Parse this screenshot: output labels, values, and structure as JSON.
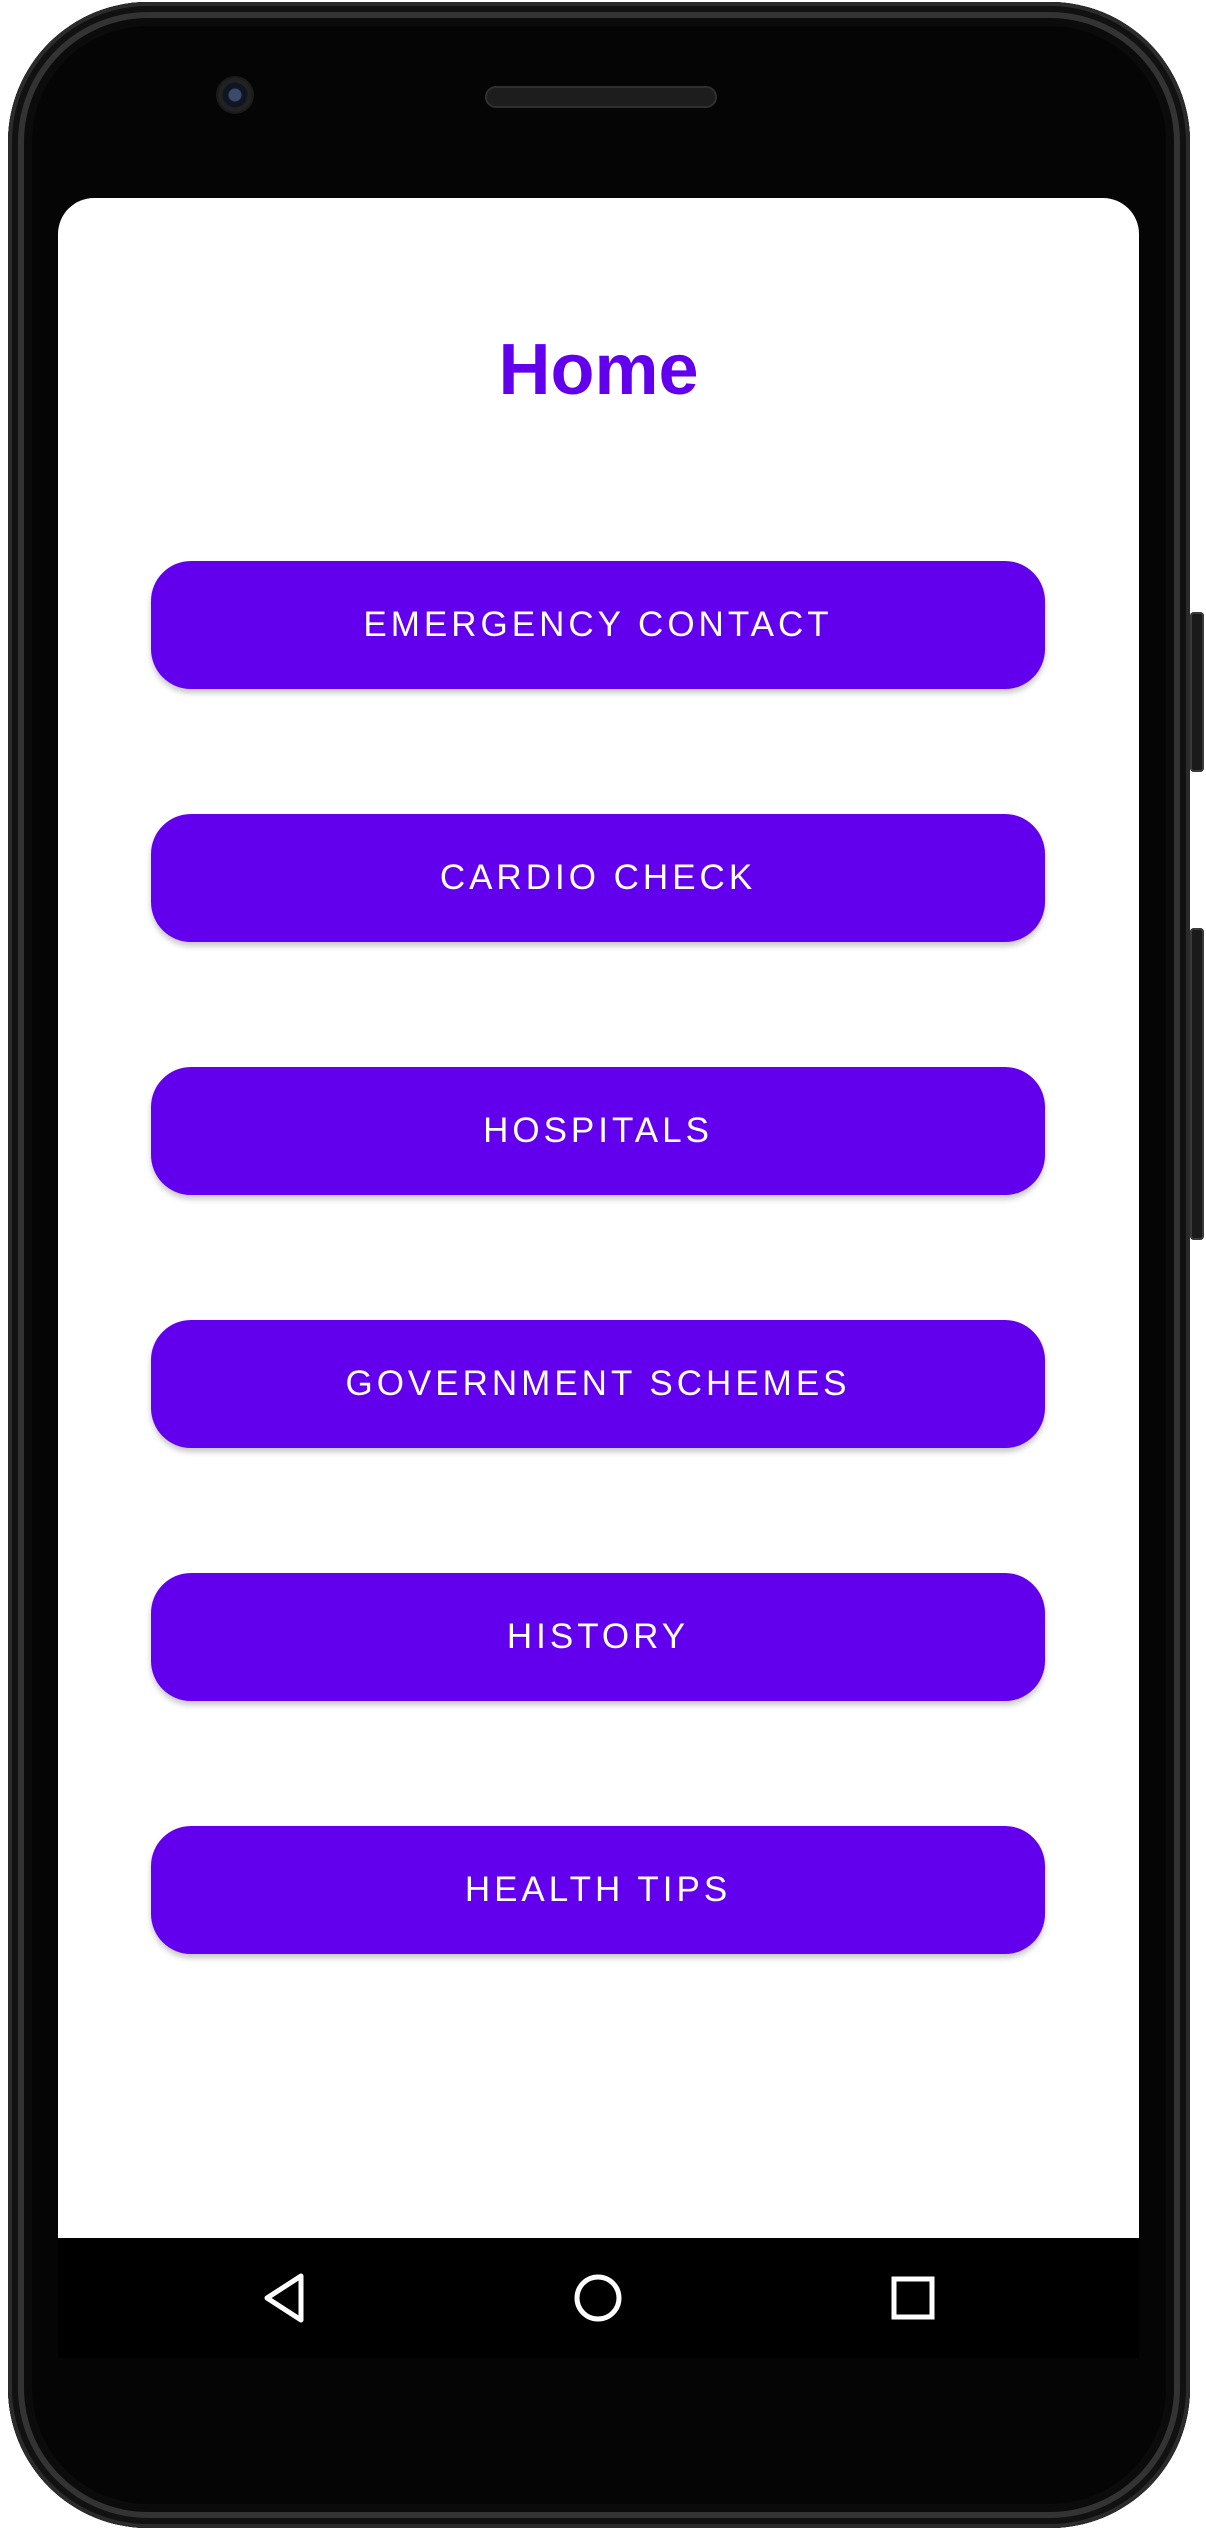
{
  "screen": {
    "title": "Home"
  },
  "menu": {
    "buttons": [
      {
        "label": "EMERGENCY CONTACT"
      },
      {
        "label": "CARDIO CHECK"
      },
      {
        "label": "HOSPITALS"
      },
      {
        "label": "GOVERNMENT SCHEMES"
      },
      {
        "label": "HISTORY"
      },
      {
        "label": "HEALTH TIPS"
      }
    ]
  },
  "navigation": {
    "icons": [
      "back-icon",
      "home-icon",
      "recents-icon"
    ]
  },
  "colors": {
    "accent": "#6200ee",
    "button_text": "#ffffff",
    "background": "#ffffff",
    "nav_bar": "#000000"
  }
}
